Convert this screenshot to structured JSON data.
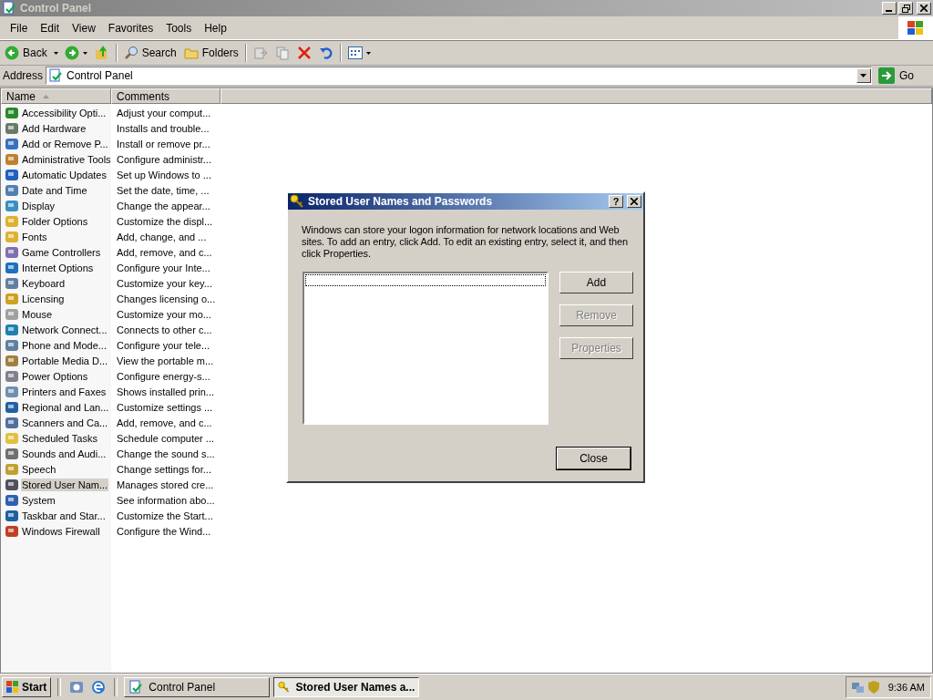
{
  "window": {
    "title": "Control Panel"
  },
  "menu": [
    "File",
    "Edit",
    "View",
    "Favorites",
    "Tools",
    "Help"
  ],
  "toolbar": {
    "back": "Back",
    "search": "Search",
    "folders": "Folders"
  },
  "address": {
    "label": "Address",
    "value": "Control Panel",
    "go": "Go"
  },
  "columns": [
    "Name",
    "Comments"
  ],
  "items": [
    {
      "name": "Accessibility Opti...",
      "comment": "Adjust your comput...",
      "selected": false
    },
    {
      "name": "Add Hardware",
      "comment": "Installs and trouble...",
      "selected": false
    },
    {
      "name": "Add or Remove P...",
      "comment": "Install or remove pr...",
      "selected": false
    },
    {
      "name": "Administrative Tools",
      "comment": "Configure administr...",
      "selected": false
    },
    {
      "name": "Automatic Updates",
      "comment": "Set up Windows to ...",
      "selected": false
    },
    {
      "name": "Date and Time",
      "comment": "Set the date, time, ...",
      "selected": false
    },
    {
      "name": "Display",
      "comment": "Change the appear...",
      "selected": false
    },
    {
      "name": "Folder Options",
      "comment": "Customize the displ...",
      "selected": false
    },
    {
      "name": "Fonts",
      "comment": "Add, change, and ...",
      "selected": false
    },
    {
      "name": "Game Controllers",
      "comment": "Add, remove, and c...",
      "selected": false
    },
    {
      "name": "Internet Options",
      "comment": "Configure your Inte...",
      "selected": false
    },
    {
      "name": "Keyboard",
      "comment": "Customize your key...",
      "selected": false
    },
    {
      "name": "Licensing",
      "comment": "Changes licensing o...",
      "selected": false
    },
    {
      "name": "Mouse",
      "comment": "Customize your mo...",
      "selected": false
    },
    {
      "name": "Network Connect...",
      "comment": "Connects to other c...",
      "selected": false
    },
    {
      "name": "Phone and Mode...",
      "comment": "Configure your tele...",
      "selected": false
    },
    {
      "name": "Portable Media D...",
      "comment": "View the portable m...",
      "selected": false
    },
    {
      "name": "Power Options",
      "comment": "Configure energy-s...",
      "selected": false
    },
    {
      "name": "Printers and Faxes",
      "comment": "Shows installed prin...",
      "selected": false
    },
    {
      "name": "Regional and Lan...",
      "comment": "Customize settings ...",
      "selected": false
    },
    {
      "name": "Scanners and Ca...",
      "comment": "Add, remove, and c...",
      "selected": false
    },
    {
      "name": "Scheduled Tasks",
      "comment": "Schedule computer ...",
      "selected": false
    },
    {
      "name": "Sounds and Audi...",
      "comment": "Change the sound s...",
      "selected": false
    },
    {
      "name": "Speech",
      "comment": "Change settings for...",
      "selected": false
    },
    {
      "name": "Stored User Nam...",
      "comment": "Manages stored cre...",
      "selected": true
    },
    {
      "name": "System",
      "comment": "See information abo...",
      "selected": false
    },
    {
      "name": "Taskbar and Star...",
      "comment": "Customize the Start...",
      "selected": false
    },
    {
      "name": "Windows Firewall",
      "comment": "Configure the Wind...",
      "selected": false
    }
  ],
  "dialog": {
    "title": "Stored User Names and Passwords",
    "help": "?",
    "description": "Windows can store your logon information for network locations and Web sites. To add an entry, click Add. To edit an existing entry, select it, and then click Properties.",
    "buttons": [
      {
        "label": "Add",
        "disabled": false
      },
      {
        "label": "Remove",
        "disabled": true
      },
      {
        "label": "Properties",
        "disabled": true
      }
    ],
    "close": "Close"
  },
  "taskbar": {
    "start": "Start",
    "tasks": [
      {
        "label": "Control Panel",
        "selected": false
      },
      {
        "label": "Stored User Names a...",
        "selected": true
      }
    ],
    "clock": "9:36 AM"
  }
}
